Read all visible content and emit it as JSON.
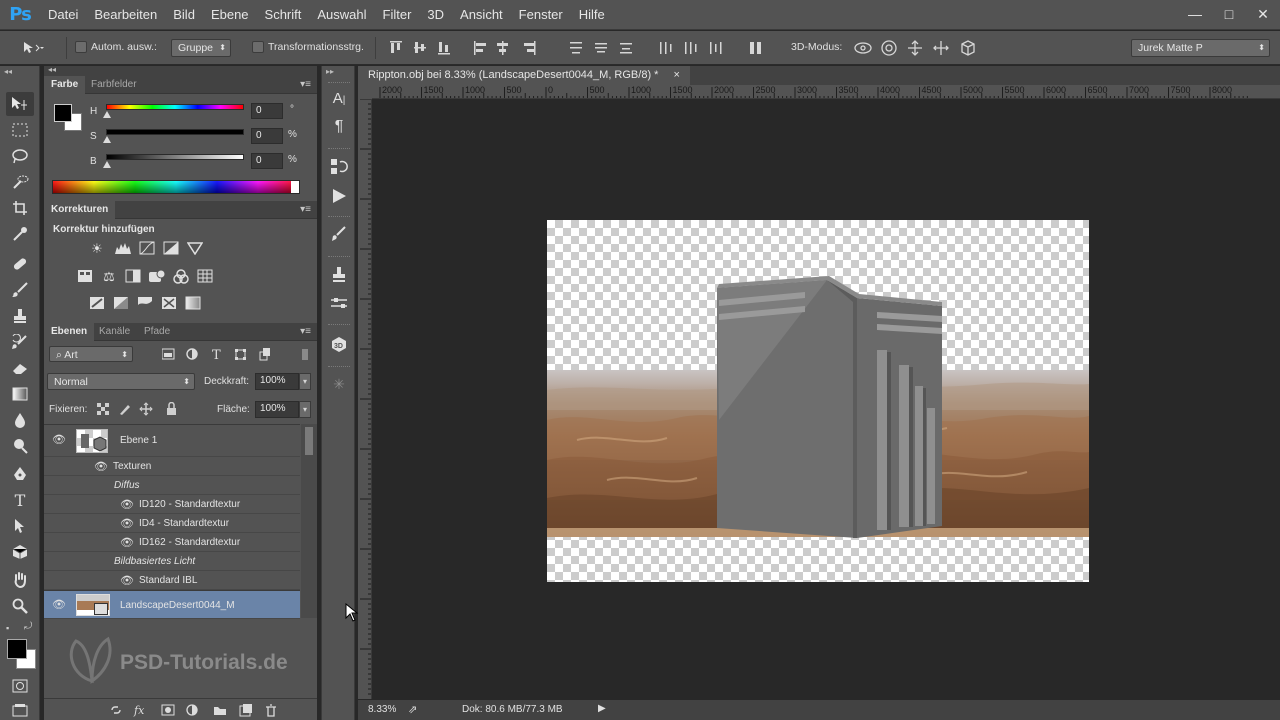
{
  "app": {
    "logo": "Ps",
    "accent": "#2fa3f5"
  },
  "menu": [
    "Datei",
    "Bearbeiten",
    "Bild",
    "Ebene",
    "Schrift",
    "Auswahl",
    "Filter",
    "3D",
    "Ansicht",
    "Fenster",
    "Hilfe"
  ],
  "window_controls": {
    "minimize": "—",
    "maximize": "□",
    "close": "✕"
  },
  "options": {
    "auto_select_label": "Autom. ausw.:",
    "auto_select_value": "Gruppe",
    "transform_label": "Transformationsstrg.",
    "mode_3d_label": "3D-Modus:",
    "workspace": "Jurek Matte P"
  },
  "color_panel": {
    "tabs": [
      "Farbe",
      "Farbfelder"
    ],
    "sliders": [
      {
        "label": "H",
        "value": "0",
        "unit": "°"
      },
      {
        "label": "S",
        "value": "0",
        "unit": "%"
      },
      {
        "label": "B",
        "value": "0",
        "unit": "%"
      }
    ],
    "foreground": "#000000",
    "background": "#ffffff"
  },
  "adjustments_panel": {
    "tabs": [
      "Korrekturen"
    ],
    "heading": "Korrektur hinzufügen"
  },
  "layers_panel": {
    "tabs": [
      "Ebenen",
      "Kanäle",
      "Pfade"
    ],
    "filter_kind": "Art",
    "blend_mode": "Normal",
    "opacity_label": "Deckkraft:",
    "opacity_value": "100%",
    "lock_label": "Fixieren:",
    "fill_label": "Fläche:",
    "fill_value": "100%",
    "layers": [
      {
        "name": "Ebene 1"
      },
      {
        "name": "Texturen"
      },
      {
        "name": "Diffus"
      },
      {
        "name": "ID120 - Standardtextur"
      },
      {
        "name": "ID4 - Standardtextur"
      },
      {
        "name": "ID162 - Standardtextur"
      },
      {
        "name": "Bildbasiertes Licht"
      },
      {
        "name": "Standard IBL"
      },
      {
        "name": "LandscapeDesert0044_M",
        "selected": true
      }
    ],
    "selected_color": "#6a84a8"
  },
  "watermark": "PSD-Tutorials.de",
  "document": {
    "tab_title": "Rippton.obj bei 8.33% (LandscapeDesert0044_M, RGB/8) *",
    "close": "×",
    "ruler_ticks": [
      "2000",
      "1500",
      "1000",
      "500",
      "0",
      "500",
      "1000",
      "1500",
      "2000",
      "2500",
      "3000",
      "3500",
      "4000",
      "4500",
      "5000",
      "5500",
      "6000",
      "6500",
      "7000",
      "7500",
      "8000"
    ]
  },
  "status": {
    "zoom": "8.33%",
    "doc_info": "Dok: 80.6 MB/77.3 MB"
  }
}
